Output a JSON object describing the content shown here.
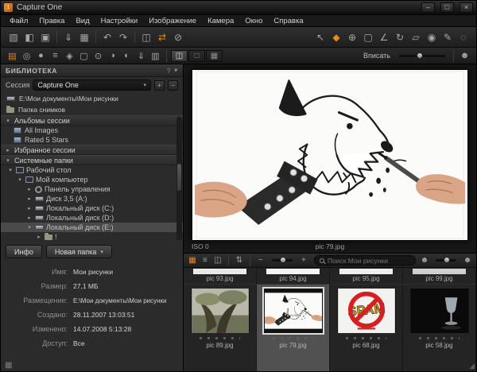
{
  "colors": {
    "accent": "#e8891e",
    "selection": "#515151",
    "background": "#1e1e1e"
  },
  "window": {
    "title": "Capture One",
    "minimize": "–",
    "maximize": "□",
    "close": "×"
  },
  "menu": {
    "items": [
      "Файл",
      "Правка",
      "Вид",
      "Настройки",
      "Изображение",
      "Камера",
      "Окно",
      "Справка"
    ]
  },
  "icons": {
    "app": "1",
    "new": "▧",
    "open": "◧",
    "save": "▣",
    "import": "⇓",
    "print": "▦",
    "undo": "↶",
    "redo": "↷",
    "copy": "◫",
    "apply": "⇄",
    "reset": "⊘",
    "cursor": "↖",
    "pan": "◆",
    "loupe": "⊕",
    "crop": "▢",
    "straighten": "∠",
    "rotate": "↻",
    "overlay": "▱",
    "spot": "◉",
    "draw": "✎",
    "erase": "◌",
    "library": "▤",
    "camera": "◎",
    "capture": "●",
    "naming": "≡",
    "styles": "◈",
    "adjust": "◐",
    "focus": "⊙",
    "exposure": "◑",
    "output": "⇓",
    "batch": "▥",
    "view_multi": "◫",
    "view_single": "□",
    "view_grid": "▦",
    "b_grid": "▦",
    "b_list": "≡",
    "b_compare": "◫",
    "b_sort": "⇅",
    "zoom_out": "−",
    "zoom_in": "+",
    "user": "☻",
    "help": "?",
    "chev_down": "▾",
    "chev_right": "▸",
    "plus": "+",
    "minus": "−",
    "tools": "▦",
    "grip": "◢"
  },
  "toolbar2": {
    "fit_label": "Вписать"
  },
  "library": {
    "header": "БИБЛИОТЕКА",
    "session_label": "Сессия",
    "session_value": "Capture One",
    "path": "E:\\Мои документы\\Мои рисунки",
    "capture_folder": "Папка снимков",
    "albums_header": "Альбомы сессии",
    "albums": [
      {
        "label": "All Images"
      },
      {
        "label": "Rated 5 Stars"
      }
    ],
    "favorites_header": "Избранное сессии",
    "system_header": "Системные папки",
    "tree": [
      {
        "label": "Рабочий стол"
      },
      {
        "label": "Мой компьютер"
      },
      {
        "label": "Панель управления"
      },
      {
        "label": "Диск 3,5 (A:)"
      },
      {
        "label": "Локальный диск (C:)"
      },
      {
        "label": "Локальный диск (D:)"
      },
      {
        "label": "Локальный диск (E:)"
      },
      {
        "label": "!"
      }
    ],
    "info_button": "Инфо",
    "new_folder_button": "Новая папка",
    "info": [
      {
        "label": "Имя:",
        "value": "Мои рисунки"
      },
      {
        "label": "Размер:",
        "value": "27,1 МБ"
      },
      {
        "label": "Размещение:",
        "value": "E:\\Мои документы\\Мои рисунки"
      },
      {
        "label": "Создано:",
        "value": "28.11.2007 13:03:51"
      },
      {
        "label": "Изменено:",
        "value": "14.07.2008 5:13:28"
      },
      {
        "label": "Доступ:",
        "value": "Все"
      }
    ]
  },
  "viewer": {
    "iso": "ISO 0",
    "caption": "pic 79.jpg"
  },
  "browser": {
    "search_placeholder": "Поиск Мои рисунки",
    "row1": [
      {
        "name": "pic 93.jpg"
      },
      {
        "name": "pic 94.jpg"
      },
      {
        "name": "pic 95.jpg"
      },
      {
        "name": "pic 99.jpg"
      }
    ],
    "row2": [
      {
        "name": "pic 89.jpg"
      },
      {
        "name": "pic 79.jpg"
      },
      {
        "name": "pic 68.jpg"
      },
      {
        "name": "pic 58.jpg"
      }
    ]
  },
  "spam_text": "SPAM"
}
